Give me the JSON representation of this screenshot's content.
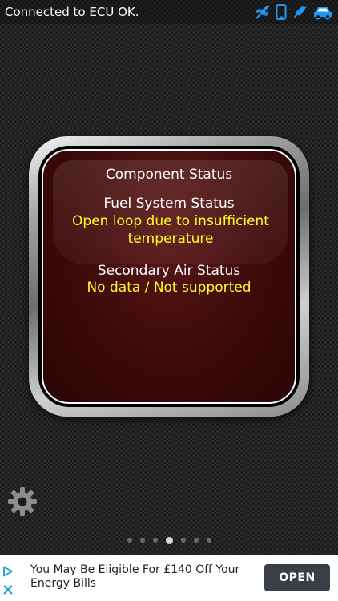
{
  "status_bar": {
    "text": "Connected to ECU OK.",
    "icons": [
      "satellite-off-icon",
      "phone-icon",
      "plug-icon",
      "car-icon"
    ],
    "icon_color": "#2196f3"
  },
  "panel": {
    "title": "Component Status",
    "fuel_system": {
      "label": "Fuel System Status",
      "value": "Open loop due to insufficient temperature"
    },
    "secondary_air": {
      "label": "Secondary Air Status",
      "value": "No data / Not supported"
    },
    "label_color": "#ffffff",
    "value_color": "#ffff22"
  },
  "settings": {
    "icon": "gear-icon"
  },
  "pager": {
    "count": 7,
    "active_index": 3
  },
  "ad": {
    "text": "You May Be Eligible For £140 Off Your Energy Bills",
    "button_label": "OPEN",
    "icons": [
      "ad-choices-icon",
      "close-icon"
    ]
  }
}
